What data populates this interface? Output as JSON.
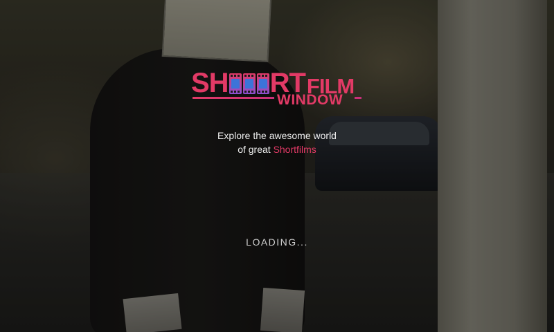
{
  "splash": {
    "logo": {
      "line1_big": "SH",
      "line1_rest": "RT",
      "line1_small": "FILM",
      "line2": "WINDOW"
    },
    "tagline": {
      "line1": "Explore the awesome world",
      "line2_prefix": "of great ",
      "line2_accent": "Shortfilms"
    },
    "loading_text": "LOADING..."
  },
  "colors": {
    "accent": "#e23a66",
    "accent_gradient_end": "#8a4fd0",
    "film_blue": "#3c74d8",
    "text": "#eeeeee"
  },
  "icons": [
    "film-strip-icon"
  ]
}
